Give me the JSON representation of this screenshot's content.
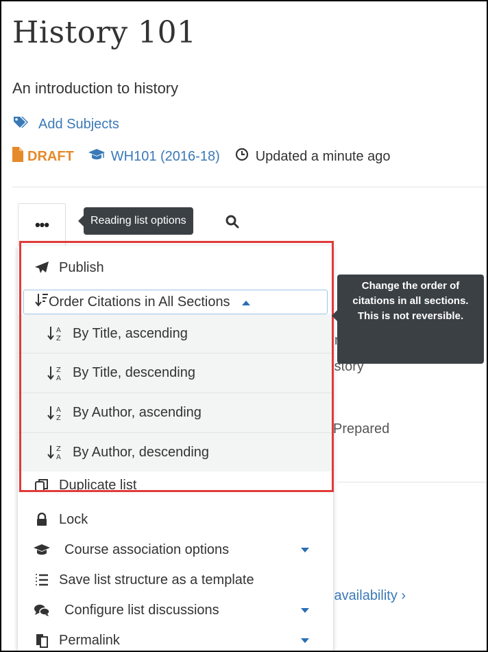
{
  "page": {
    "title": "History 101",
    "subtitle": "An introduction to history",
    "add_subjects": "Add Subjects",
    "status": "DRAFT",
    "course": "WH101 (2016-18)",
    "updated": "Updated a minute ago"
  },
  "toolbar": {
    "more_label": "•••",
    "tooltip": "Reading list options"
  },
  "menu": {
    "publish": "Publish",
    "order_all": "Order Citations in All Sections",
    "order_options": [
      {
        "label": "By Title, ascending",
        "icon": "sort-alpha-asc-icon"
      },
      {
        "label": "By Title, descending",
        "icon": "sort-alpha-desc-icon"
      },
      {
        "label": "By Author, ascending",
        "icon": "sort-alpha-asc-icon"
      },
      {
        "label": "By Author, descending",
        "icon": "sort-alpha-desc-icon"
      }
    ],
    "duplicate": "Duplicate list",
    "lock": "Lock",
    "course_assoc": "Course association options",
    "save_template": "Save list structure as a template",
    "discussions": "Configure list discussions",
    "permalink": "Permalink"
  },
  "order_tooltip": "Change the order of citations in all sections. This is not reversible.",
  "background": {
    "fragment_r": "r",
    "fragment_history": "history",
    "fragment_prepared": "Prepared",
    "fragment_availability": "k availability ›"
  },
  "colors": {
    "link": "#3a79b7",
    "draft": "#e58a2a",
    "highlight": "#e03a3a",
    "tooltip_bg": "#3b4045"
  }
}
